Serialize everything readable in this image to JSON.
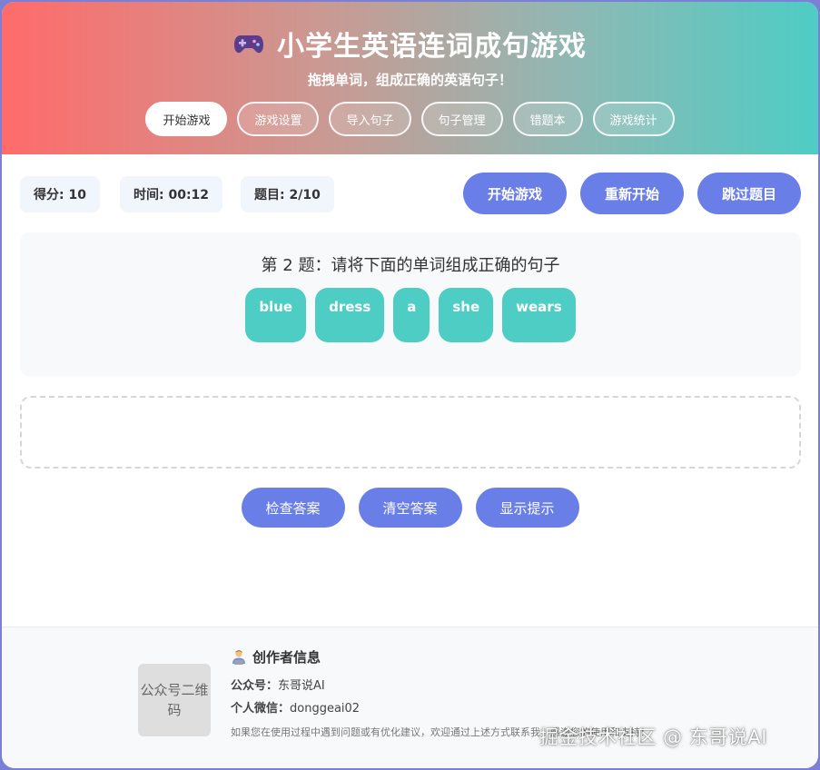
{
  "header": {
    "title": "小学生英语连词成句游戏",
    "subtitle": "拖拽单词，组成正确的英语句子！",
    "nav": [
      "开始游戏",
      "游戏设置",
      "导入句子",
      "句子管理",
      "错题本",
      "游戏统计"
    ]
  },
  "stats": {
    "score": "得分: 10",
    "time": "时间: 00:12",
    "question": "题目: 2/10"
  },
  "actions": {
    "start": "开始游戏",
    "restart": "重新开始",
    "skip": "跳过题目"
  },
  "question": {
    "prompt": "第 2 题：请将下面的单词组成正确的句子",
    "words": [
      "blue",
      "dress",
      "a",
      "she",
      "wears"
    ]
  },
  "controls": {
    "check": "检查答案",
    "clear": "清空答案",
    "hint": "显示提示"
  },
  "footer": {
    "qr_label": "公众号二维码",
    "title": "创作者信息",
    "account_label": "公众号：",
    "account_value": "东哥说AI",
    "wechat_label": "个人微信：",
    "wechat_value": "donggeai02",
    "note": "如果您在使用过程中遇到问题或有优化建议，欢迎通过上述方式联系我！感谢您的使用和支持！"
  },
  "watermark": "掘金技术社区 @ 东哥说AI",
  "colors": {
    "primary": "#6a7ee8",
    "word": "#4ecdc4",
    "gradient_start": "#ff6b6b",
    "gradient_end": "#4ecdc4"
  }
}
